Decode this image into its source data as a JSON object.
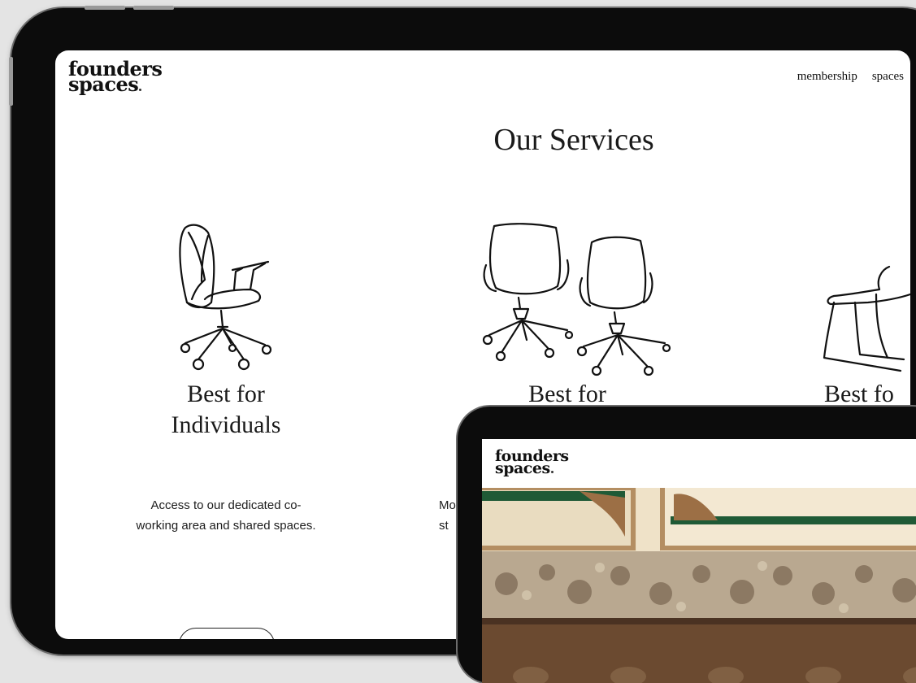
{
  "main_site": {
    "logo": {
      "line1": "founders",
      "line2": "spaces"
    },
    "nav": {
      "items": [
        "membership",
        "spaces"
      ]
    },
    "section_title": "Our Services",
    "cards": [
      {
        "title_line1": "Best for",
        "title_line2": "Individuals",
        "desc_line1": "Access to our dedicated co-",
        "desc_line2": "working area and shared spaces."
      },
      {
        "title_line1": "Best for",
        "title_line2": "",
        "desc_line1": "Mo",
        "desc_line2": "st"
      },
      {
        "title_line1": "Best fo",
        "title_line2": "",
        "desc_line1": "",
        "desc_line2": ""
      }
    ]
  },
  "secondary_site": {
    "logo": {
      "line1": "founders",
      "line2": "spaces"
    }
  },
  "colors": {
    "device_frame": "#0c0c0c",
    "screen_bg": "#ffffff",
    "wall_green": "#1f5a36",
    "wall_cream": "#f1e6cf",
    "wainscot_brown": "#6b4a30"
  },
  "icons": [
    "office-chair-icon",
    "double-chair-icon",
    "sled-chair-icon"
  ]
}
